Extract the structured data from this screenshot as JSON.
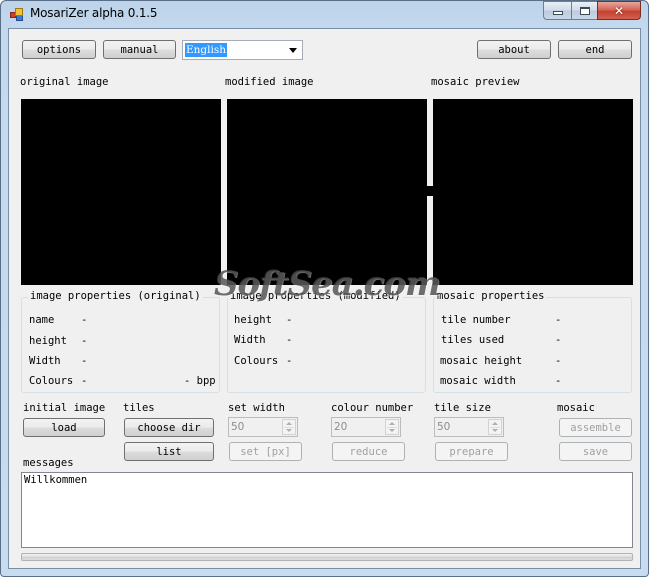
{
  "window": {
    "title": "MosariZer alpha 0.1.5",
    "caption_buttons": {
      "minimize": "minimize-icon",
      "maximize": "maximize-icon",
      "close": "close-icon"
    }
  },
  "toolbar": {
    "options_label": "options",
    "manual_label": "manual",
    "language": {
      "selected": "English"
    },
    "about_label": "about",
    "end_label": "end"
  },
  "panels": {
    "original_label": "original image",
    "modified_label": "modified image",
    "preview_label": "mosaic preview"
  },
  "original_props": {
    "title": "image properties (original)",
    "rows": [
      {
        "label": "name",
        "value": "-"
      },
      {
        "label": "height",
        "value": "-"
      },
      {
        "label": "Width",
        "value": "-"
      },
      {
        "label": "Colours",
        "value": "-",
        "extra": "- bpp"
      }
    ]
  },
  "modified_props": {
    "title": "image properties (modified)",
    "rows": [
      {
        "label": "height",
        "value": "-"
      },
      {
        "label": "Width",
        "value": "-"
      },
      {
        "label": "Colours",
        "value": "-"
      }
    ]
  },
  "mosaic_props": {
    "title": "mosaic properties",
    "rows": [
      {
        "label": "tile number",
        "value": "-"
      },
      {
        "label": "tiles used",
        "value": "-"
      },
      {
        "label": "mosaic height",
        "value": "-"
      },
      {
        "label": "mosaic width",
        "value": "-"
      }
    ]
  },
  "controls": {
    "initial_image": {
      "label": "initial image",
      "load": "load"
    },
    "tiles": {
      "label": "tiles",
      "choose_dir": "choose dir",
      "list": "list"
    },
    "set_width": {
      "label": "set width",
      "value": "50",
      "button": "set [px]"
    },
    "colour_number": {
      "label": "colour number",
      "value": "20",
      "button": "reduce"
    },
    "tile_size": {
      "label": "tile size",
      "value": "50",
      "button": "prepare"
    },
    "mosaic": {
      "label": "mosaic",
      "assemble": "assemble",
      "save": "save"
    }
  },
  "messages": {
    "label": "messages",
    "text": "Willkommen"
  },
  "progress": {
    "value_percent": 0
  },
  "watermark": "SoftSea.com"
}
